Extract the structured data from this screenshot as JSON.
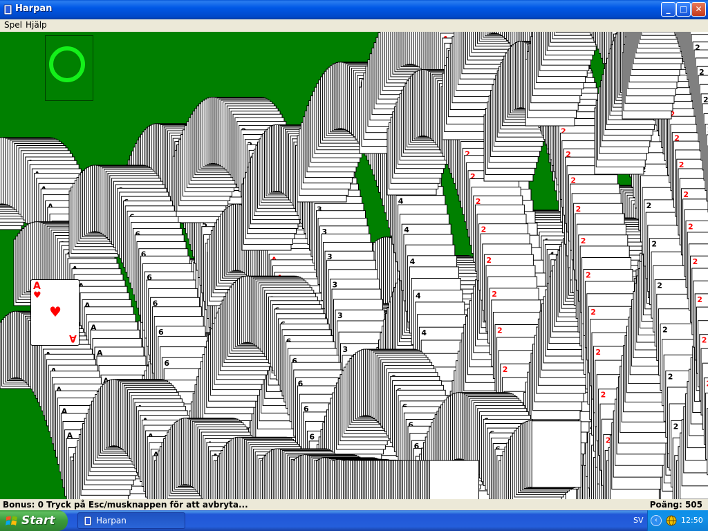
{
  "window": {
    "title": "Harpan",
    "buttons": {
      "minimize": "_",
      "maximize": "□",
      "close": "✕"
    }
  },
  "menu": [
    "Spel",
    "Hjälp"
  ],
  "board": {
    "background": "#008000",
    "stock_marker_color": "#14f01a",
    "visible_card": {
      "rank": "A",
      "suit": "♥",
      "color": "#ff0000"
    },
    "trail_labels": [
      "A",
      "2",
      "3",
      "4",
      "5",
      "6"
    ]
  },
  "status": {
    "left": "Bonus: 0  Tryck på Esc/musknappen för att avbryta...",
    "right": "Poäng: 505"
  },
  "taskbar": {
    "start_label": "Start",
    "task_label": "Harpan",
    "language": "SV",
    "clock": "12:50"
  }
}
